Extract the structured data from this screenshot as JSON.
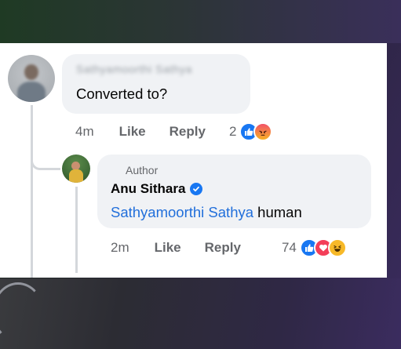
{
  "comment1": {
    "author_name": "Sathyamoorthi Sathya",
    "text": "Converted to?",
    "time": "4m",
    "like_label": "Like",
    "reply_label": "Reply",
    "reaction_count": "2",
    "reactions": [
      "like-icon",
      "angry-icon"
    ]
  },
  "comment2": {
    "badge": "Author",
    "author_name": "Anu Sithara",
    "verified": "verified-badge-icon",
    "mention": "Sathyamoorthi Sathya",
    "text": " human",
    "time": "2m",
    "like_label": "Like",
    "reply_label": "Reply",
    "reaction_count": "74",
    "reactions": [
      "like-icon",
      "love-icon",
      "haha-icon"
    ]
  },
  "colors": {
    "link": "#216fdb",
    "like": "#1877f2",
    "love": "#f33e58",
    "haha": "#f7b928",
    "meta_text": "#65676b"
  }
}
